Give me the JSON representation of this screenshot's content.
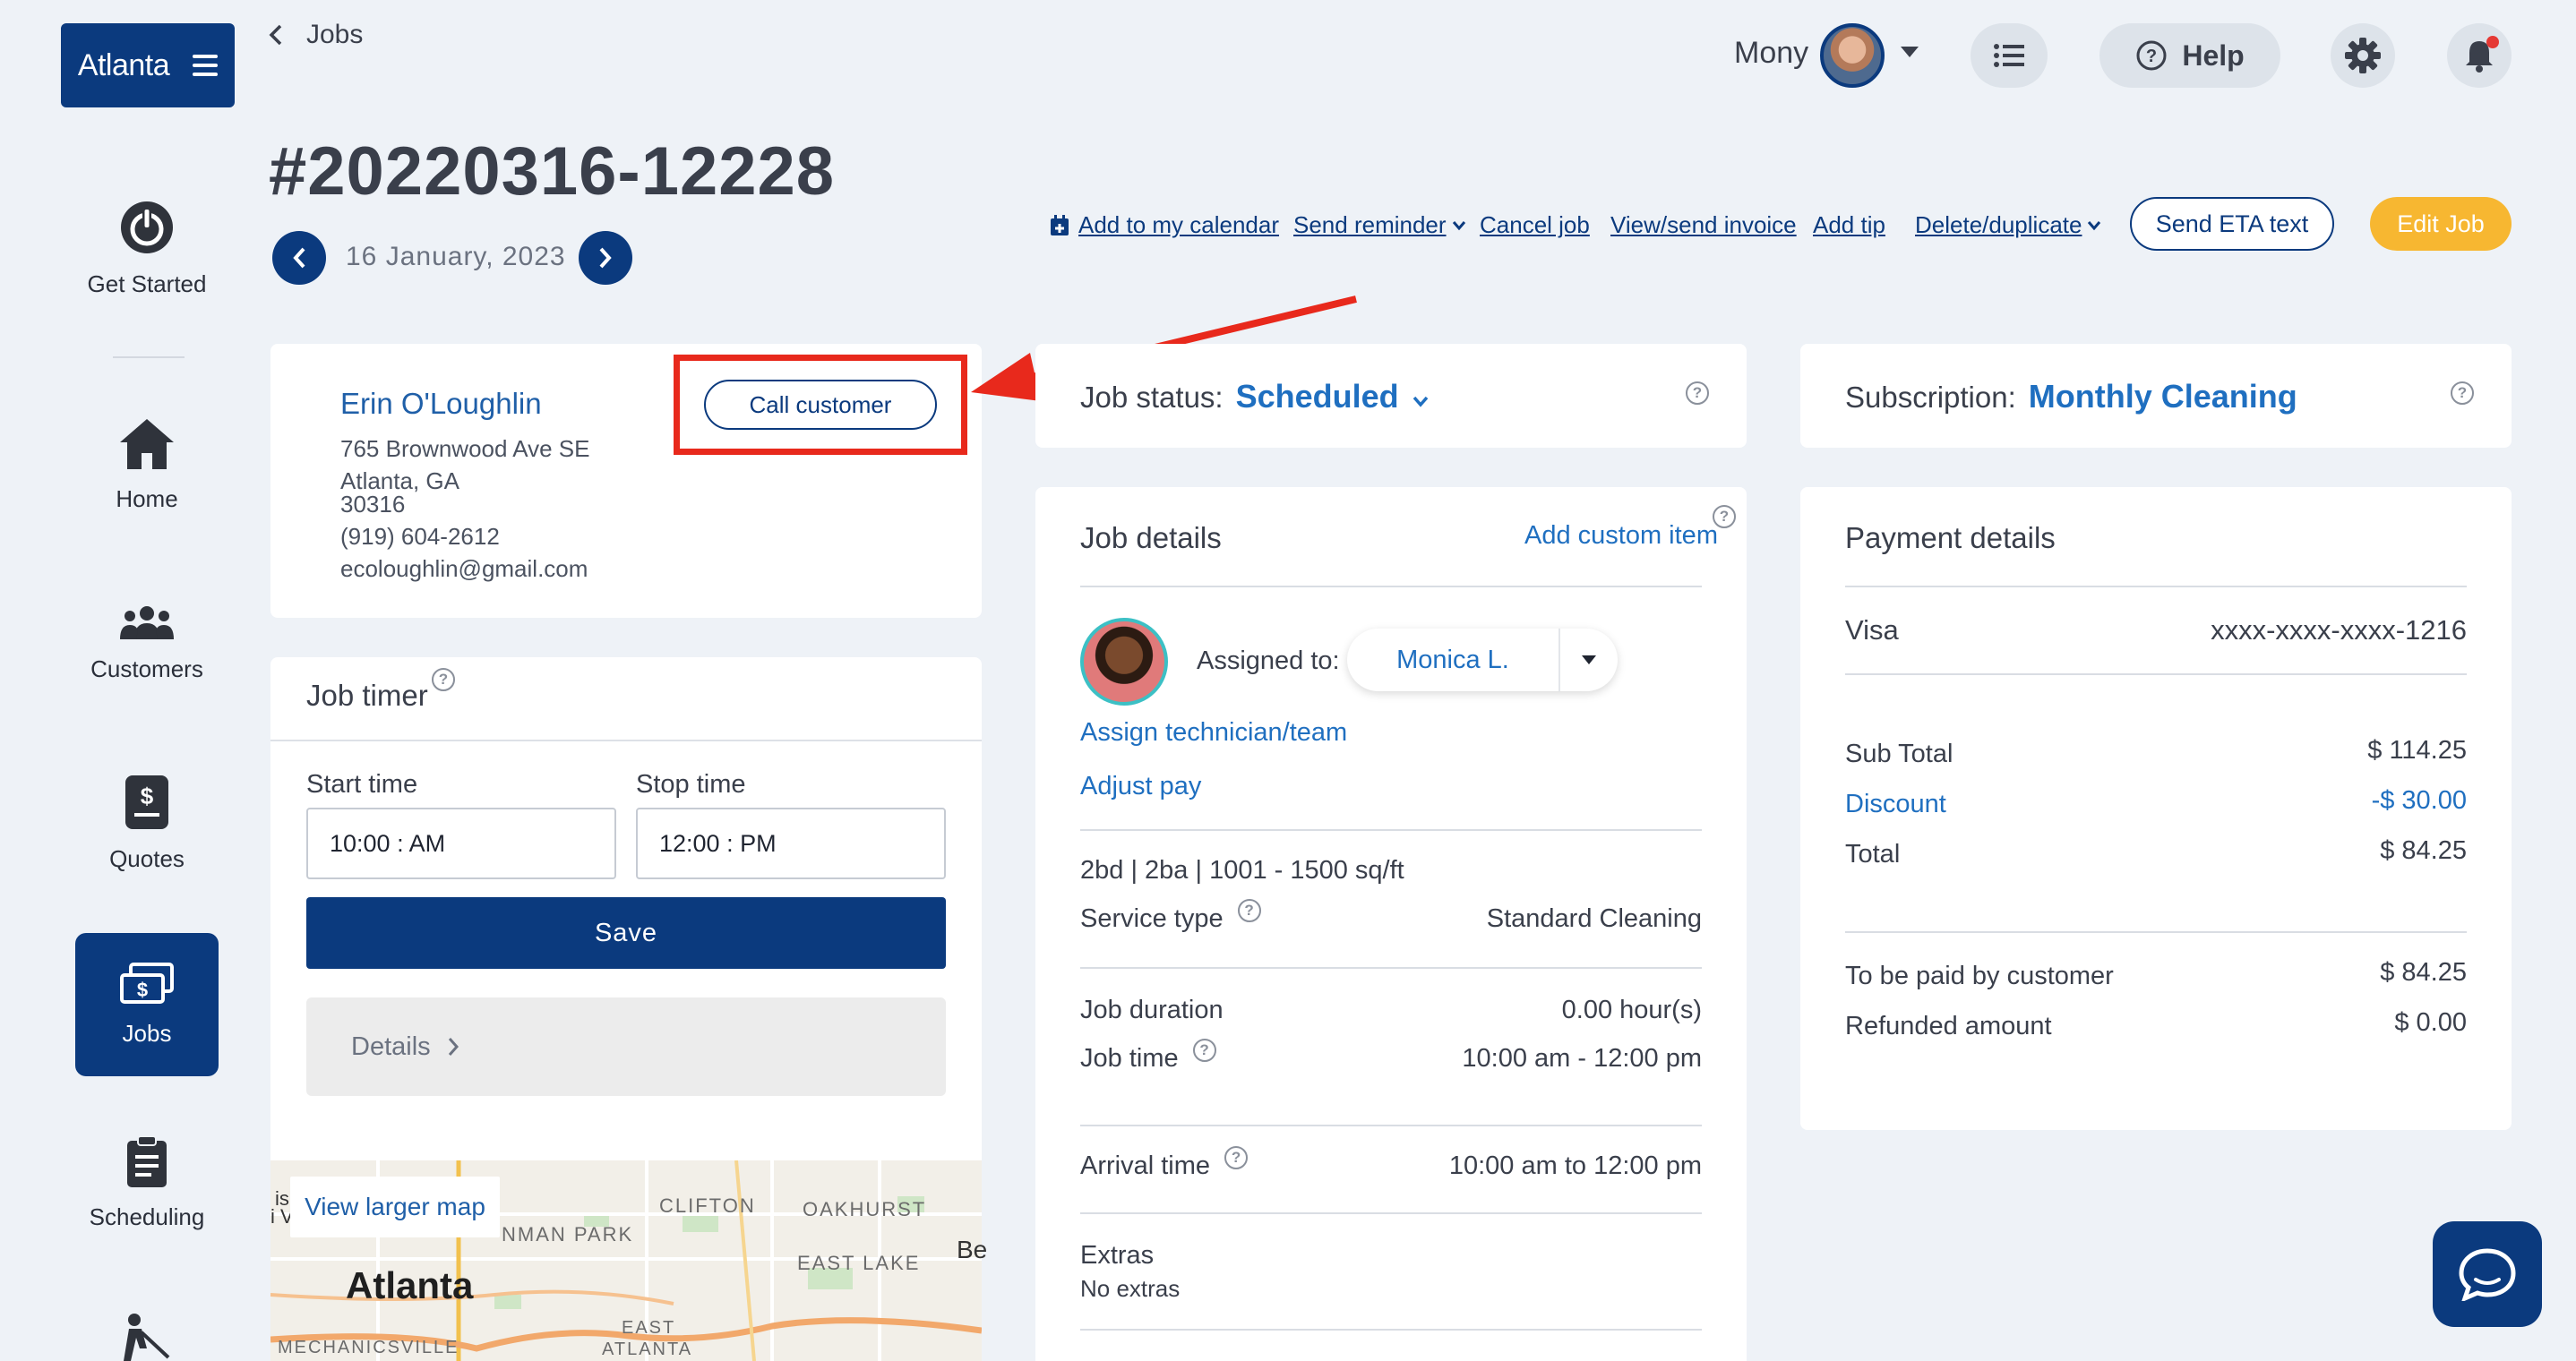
{
  "sidebar": {
    "brand": "Atlanta",
    "items": [
      {
        "label": "Get Started",
        "icon": "power-icon"
      },
      {
        "label": "Home",
        "icon": "home-icon"
      },
      {
        "label": "Customers",
        "icon": "customers-icon"
      },
      {
        "label": "Quotes",
        "icon": "quote-icon"
      },
      {
        "label": "Jobs",
        "icon": "jobs-icon",
        "active": true
      },
      {
        "label": "Scheduling",
        "icon": "clipboard-icon"
      }
    ]
  },
  "header": {
    "back_label": "Jobs",
    "job_number": "#20220316-12228",
    "date": "16 January, 2023",
    "user_name": "Mony",
    "help_label": "Help"
  },
  "actions": {
    "add_calendar": "Add to my calendar",
    "send_reminder": "Send reminder",
    "cancel_job": "Cancel job",
    "view_invoice": "View/send invoice",
    "add_tip": "Add tip",
    "delete_duplicate": "Delete/duplicate",
    "send_eta": "Send ETA text",
    "edit_job": "Edit Job"
  },
  "customer": {
    "name": "Erin O'Loughlin",
    "street": "765 Brownwood Ave SE",
    "city": "Atlanta, GA",
    "zip": "30316",
    "phone": "(919) 604-2612",
    "email": "ecoloughlin@gmail.com",
    "call_label": "Call customer"
  },
  "timer": {
    "title": "Job timer",
    "start_label": "Start time",
    "stop_label": "Stop time",
    "start_value": "10:00 : AM",
    "stop_value": "12:00 : PM",
    "save_label": "Save",
    "details_label": "Details"
  },
  "map": {
    "view_larger": "View larger map",
    "labels": {
      "city": "Atlanta",
      "clifton": "CLIFTON",
      "oakhurst": "OAKHURST",
      "east_lake": "EAST LAKE",
      "inman_park": "NMAN PARK",
      "east_atlanta_1": "EAST",
      "east_atlanta_2": "ATLANTA",
      "mechanicsville": "MECHANICSVILLE",
      "be": "Be",
      "is": "is",
      "iv": "i V"
    }
  },
  "status": {
    "label": "Job status:",
    "value": "Scheduled"
  },
  "job_details": {
    "title": "Job details",
    "add_custom": "Add custom item",
    "assigned_label": "Assigned to:",
    "technician": "Monica L.",
    "assign_link": "Assign technician/team",
    "adjust_pay": "Adjust pay",
    "summary": "2bd | 2ba | 1001 - 1500 sq/ft",
    "service_type_label": "Service type",
    "service_type_value": "Standard Cleaning",
    "duration_label": "Job duration",
    "duration_value": "0.00 hour(s)",
    "job_time_label": "Job time",
    "job_time_value": "10:00 am - 12:00 pm",
    "arrival_label": "Arrival time",
    "arrival_value": "10:00 am to 12:00 pm",
    "extras_label": "Extras",
    "extras_value": "No extras"
  },
  "subscription": {
    "label": "Subscription:",
    "value": "Monthly Cleaning"
  },
  "payment": {
    "title": "Payment details",
    "card_type": "Visa",
    "card_number": "xxxx-xxxx-xxxx-1216",
    "subtotal_label": "Sub Total",
    "subtotal_value": "$ 114.25",
    "discount_label": "Discount",
    "discount_value": "-$ 30.00",
    "total_label": "Total",
    "total_value": "$ 84.25",
    "to_pay_label": "To be paid by customer",
    "to_pay_value": "$ 84.25",
    "refunded_label": "Refunded amount",
    "refunded_value": "$ 0.00"
  },
  "colors": {
    "brand_navy": "#0b3a7e",
    "link_blue": "#1f6fc0",
    "edit_orange": "#f7b731",
    "highlight_red": "#e8291c",
    "background": "#eef2f7"
  }
}
